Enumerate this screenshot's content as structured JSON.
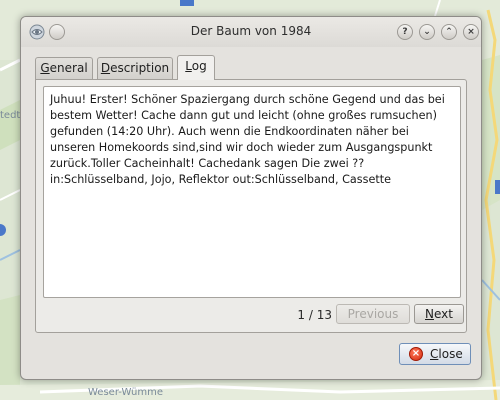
{
  "window": {
    "title": "Der Baum von 1984"
  },
  "titlebar_buttons": {
    "help": "?",
    "minimize": "⌄",
    "maximize": "⌃",
    "close": "×"
  },
  "tabs": [
    {
      "label_pre": "",
      "label_ul": "G",
      "label_post": "eneral"
    },
    {
      "label_pre": "",
      "label_ul": "D",
      "label_post": "escription"
    },
    {
      "label_pre": "",
      "label_ul": "L",
      "label_post": "og"
    }
  ],
  "log": {
    "text": "Juhuu! Erster! Schöner Spaziergang durch schöne Gegend und das bei bestem Wetter! Cache dann gut und leicht (ohne großes rumsuchen) gefunden (14:20 Uhr). Auch wenn die Endkoordinaten näher bei unseren Homekoords sind,sind wir doch wieder zum Ausgangspunkt zurück.Toller Cacheinhalt! Cachedank sagen Die zwei ?? in:Schlüsselband, Jojo, Reflektor out:Schlüsselband, Cassette"
  },
  "pager": {
    "counter": "1 / 13",
    "previous_label": "Previous",
    "next_label_ul": "N",
    "next_label_post": "ext"
  },
  "footer": {
    "close_label_ul": "C",
    "close_label_post": "lose"
  },
  "map": {
    "label_left": "tedt",
    "label_bottom": "Weser-Wümme"
  }
}
